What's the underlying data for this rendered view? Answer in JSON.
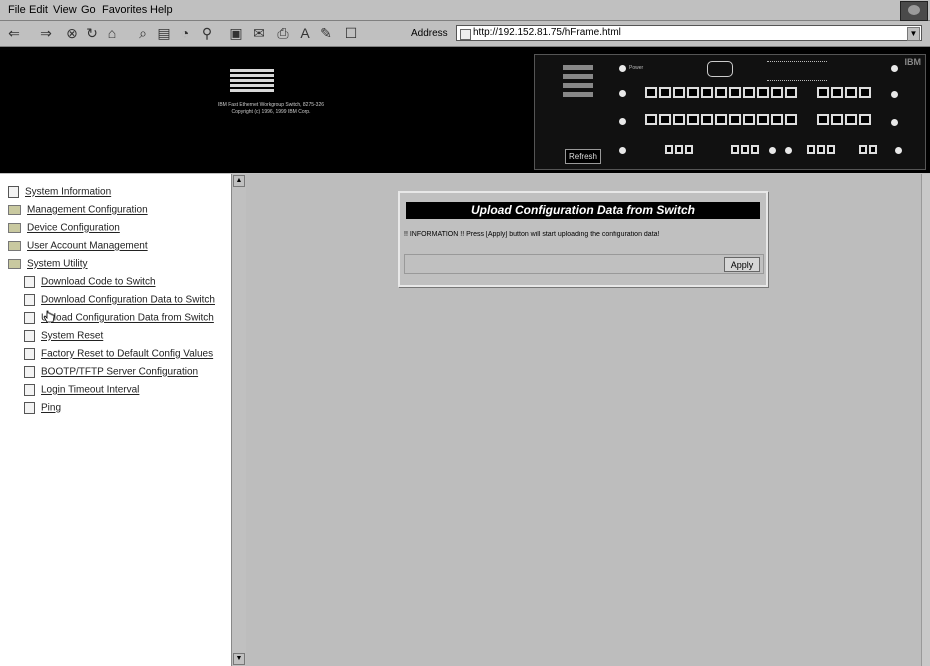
{
  "menu": [
    "File",
    "Edit",
    "View",
    "Go",
    "Favorites",
    "Help"
  ],
  "toolbar": {
    "address_label": "Address",
    "url": "http://192.152.81.75/hFrame.html"
  },
  "banner": {
    "logo": "IBM",
    "line1": "IBM Fast Ethernet Workgroup Switch, 8275-326",
    "line2": "Copyright (c) 1996, 1999 IBM Corp.",
    "panel_power": "Power",
    "panel_refresh": "Refresh",
    "panel_brand": "IBM"
  },
  "nav": {
    "items": [
      {
        "label": "System Information",
        "icon": "page-icon"
      },
      {
        "label": "Management Configuration",
        "icon": "folder-icon"
      },
      {
        "label": "Device Configuration",
        "icon": "folder-icon"
      },
      {
        "label": "User Account Management",
        "icon": "folder-icon"
      },
      {
        "label": "System Utility",
        "icon": "open-folder-icon"
      },
      {
        "label": "Download Code to Switch",
        "icon": "page-icon"
      },
      {
        "label": "Download Configuration Data to Switch",
        "icon": "page-icon"
      },
      {
        "label": "Upload Configuration Data from Switch",
        "icon": "page-icon"
      },
      {
        "label": "System Reset",
        "icon": "page-icon"
      },
      {
        "label": "Factory Reset to Default Config Values",
        "icon": "page-icon"
      },
      {
        "label": "BOOTP/TFTP Server Configuration",
        "icon": "page-icon"
      },
      {
        "label": "Login Timeout Interval",
        "icon": "page-icon"
      },
      {
        "label": "Ping",
        "icon": "page-icon"
      }
    ]
  },
  "dialog": {
    "title": "Upload Configuration Data from Switch",
    "info": "!! INFORMATION !! Press [Apply] button will start uploading the configuration data!",
    "apply_label": "Apply"
  }
}
